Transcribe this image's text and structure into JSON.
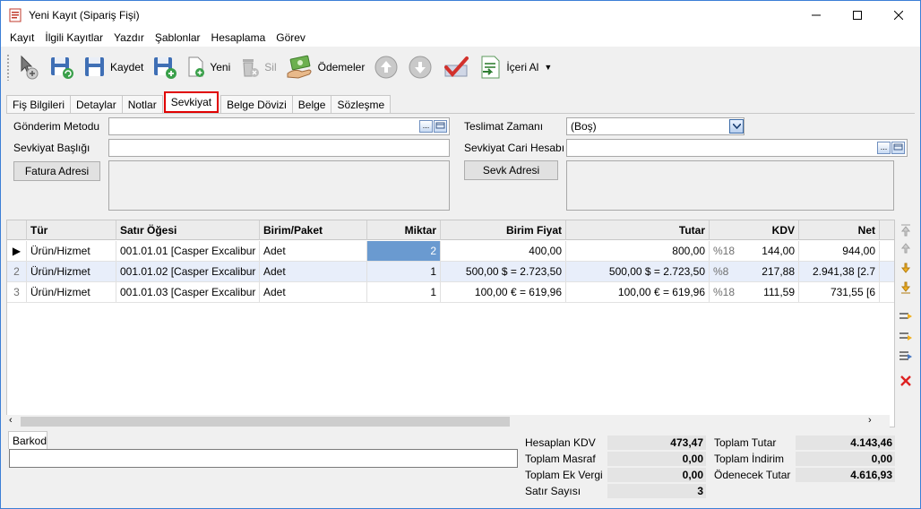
{
  "window": {
    "title": "Yeni Kayıt (Sipariş Fişi)"
  },
  "menu": [
    "Kayıt",
    "İlgili Kayıtlar",
    "Yazdır",
    "Şablonlar",
    "Hesaplama",
    "Görev"
  ],
  "toolbar": {
    "kaydet": "Kaydet",
    "yeni": "Yeni",
    "sil": "Sil",
    "odemeler": "Ödemeler",
    "iceri_al": "İçeri Al"
  },
  "tabs": [
    "Fiş Bilgileri",
    "Detaylar",
    "Notlar",
    "Sevkiyat",
    "Belge Dövizi",
    "Belge",
    "Sözleşme"
  ],
  "form": {
    "gonderim_metodu": "Gönderim Metodu",
    "sevkiyat_basligi": "Sevkiyat Başlığı",
    "fatura_adresi": "Fatura Adresi",
    "teslimat_zamani": "Teslimat Zamanı",
    "teslimat_value": "(Boş)",
    "sevkiyat_cari": "Sevkiyat Cari Hesabı",
    "sevk_adresi": "Sevk Adresi",
    "dots": "..."
  },
  "grid": {
    "columns": [
      "Tür",
      "Satır Öğesi",
      "Birim/Paket",
      "Miktar",
      "Birim Fiyat",
      "Tutar",
      "KDV",
      "Net"
    ],
    "rows": [
      {
        "n": "",
        "tur": "Ürün/Hizmet",
        "oge": "001.01.01 [Casper Excalibur ...",
        "birim": "Adet",
        "miktar": "2",
        "fiyat": "400,00",
        "tutar": "800,00",
        "kdv_oran": "%18",
        "kdv": "144,00",
        "net": "944,00"
      },
      {
        "n": "2",
        "tur": "Ürün/Hizmet",
        "oge": "001.01.02 [Casper Excalibur ...",
        "birim": "Adet",
        "miktar": "1",
        "fiyat": "500,00 $ = 2.723,50",
        "tutar": "500,00 $ = 2.723,50",
        "kdv_oran": "%8",
        "kdv": "217,88",
        "net": "2.941,38 [2.7"
      },
      {
        "n": "3",
        "tur": "Ürün/Hizmet",
        "oge": "001.01.03 [Casper Excalibur ...",
        "birim": "Adet",
        "miktar": "1",
        "fiyat": "100,00 € = 619,96",
        "tutar": "100,00 € = 619,96",
        "kdv_oran": "%18",
        "kdv": "111,59",
        "net": "731,55 [6"
      }
    ]
  },
  "barkod": {
    "tab": "Barkod"
  },
  "totals": {
    "hesaplan_kdv_lbl": "Hesaplan KDV",
    "hesaplan_kdv": "473,47",
    "toplam_masraf_lbl": "Toplam Masraf",
    "toplam_masraf": "0,00",
    "toplam_ek_vergi_lbl": "Toplam Ek Vergi",
    "toplam_ek_vergi": "0,00",
    "satir_sayisi_lbl": "Satır Sayısı",
    "satir_sayisi": "3",
    "toplam_tutar_lbl": "Toplam Tutar",
    "toplam_tutar": "4.143,46",
    "toplam_indirim_lbl": "Toplam İndirim",
    "toplam_indirim": "0,00",
    "odenecek_tutar_lbl": "Ödenecek Tutar",
    "odenecek_tutar": "4.616,93"
  }
}
